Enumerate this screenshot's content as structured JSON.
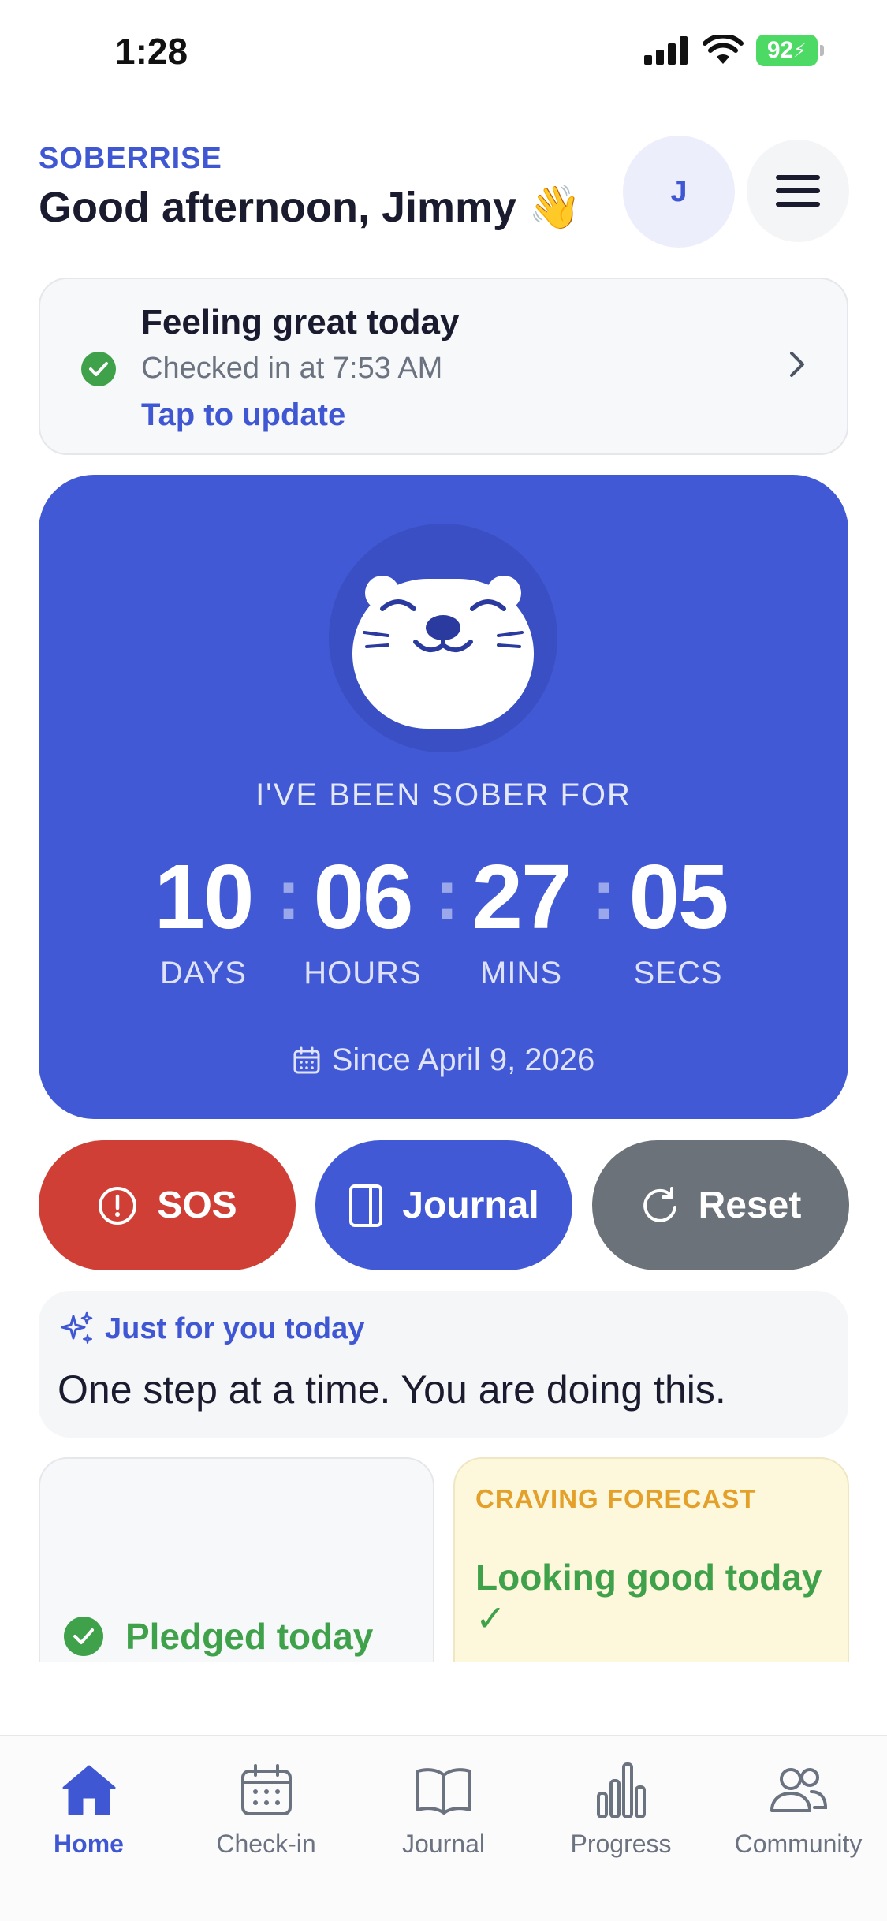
{
  "status_bar": {
    "time": "1:28",
    "battery": "92"
  },
  "header": {
    "brand": "SOBERRISE",
    "greeting": "Good afternoon, Jimmy 👋",
    "avatar_initial": "J"
  },
  "checkin": {
    "title": "Feeling great today",
    "subtitle": "Checked in at 7:53 AM",
    "link": "Tap to update"
  },
  "counter": {
    "label": "I'VE BEEN SOBER FOR",
    "days": "10",
    "hours": "06",
    "mins": "27",
    "secs": "05",
    "days_label": "DAYS",
    "hours_label": "HOURS",
    "mins_label": "MINS",
    "secs_label": "SECS",
    "since": "Since April 9, 2026"
  },
  "actions": {
    "sos": "SOS",
    "journal": "Journal",
    "reset": "Reset"
  },
  "for_you": {
    "heading": "Just for you today",
    "message": "One step at a time. You are doing this."
  },
  "pledge": {
    "text": "Pledged today"
  },
  "forecast": {
    "label": "CRAVING FORECAST",
    "text": "Looking good today ✓"
  },
  "tabs": [
    {
      "label": "Home",
      "icon": "home-icon"
    },
    {
      "label": "Check-in",
      "icon": "calendar-icon"
    },
    {
      "label": "Journal",
      "icon": "book-icon"
    },
    {
      "label": "Progress",
      "icon": "bar-chart-icon"
    },
    {
      "label": "Community",
      "icon": "people-icon"
    }
  ],
  "colors": {
    "primary": "#4259d5",
    "sos": "#cf3f36",
    "reset": "#6c7279",
    "success": "#3fa14a",
    "forecast_accent": "#e3a12b"
  }
}
